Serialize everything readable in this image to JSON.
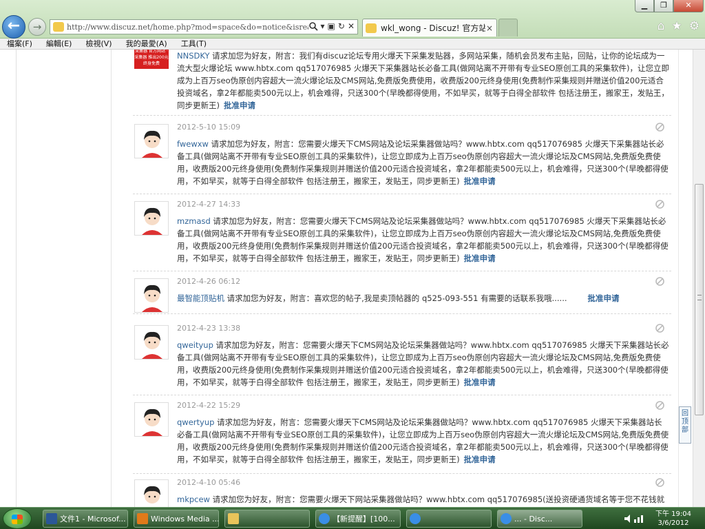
{
  "browser": {
    "url": "http://www.discuz.net/home.php?mod=space&do=notice&isread=1",
    "tab_title": "wkl_wong - Discuz! 官方站 - ...",
    "tab_close": "×",
    "window_minimize": "▁",
    "window_restore": "❐",
    "window_close": "✕",
    "back_glyph": "←",
    "forward_glyph": "→",
    "menu": [
      "檔案(F)",
      "編輯(E)",
      "檢視(V)",
      "我的最愛(A)",
      "工具(T)"
    ]
  },
  "ad_image_text": "采集器 官方网站 · 采集器 推出200元 终身免费",
  "notices": [
    {
      "time": "",
      "user": "NNSDKY",
      "text": " 请求加您为好友，附言：我们有discuz论坛专用火爆天下采集发贴器，多网站采集，随机会员发布主贴，回贴，让你的论坛成为一流大型火爆论坛 www.hbtx.com qq517076985 火爆天下采集器站长必备工具(做网站离不开带有专业SEO原创工具的采集软件)，让您立即成为上百万seo伪原创内容超大一流火爆论坛及CMS网站,免费版免费使用，收费版200元终身使用(免费制作采集规则并赠送价值200元适合投资域名，拿2年都能卖500元以上，机会难得，只送300个(早晚都得使用，不如早买，就等于白得全部软件 包括注册王，搬家王，发贴王，同步更新王)",
      "approve": "批准申请"
    },
    {
      "time": "2012-5-10 15:09",
      "user": "fwewxw",
      "text": " 请求加您为好友，附言：您需要火爆天下CMS网站及论坛采集器做站吗？www.hbtx.com qq517076985 火爆天下采集器站长必备工具(做网站离不开带有专业SEO原创工具的采集软件)，让您立即成为上百万seo伪原创内容超大一流火爆论坛及CMS网站,免费版免费使用，收费版200元终身使用(免费制作采集规则并赠送价值200元适合投资域名，拿2年都能卖500元以上，机会难得，只送300个(早晚都得使用，不如早买，就等于白得全部软件 包括注册王，搬家王，发贴王，同步更新王)",
      "approve": "批准申请"
    },
    {
      "time": "2012-4-27 14:33",
      "user": "mzmasd",
      "text": " 请求加您为好友，附言：您需要火爆天下CMS网站及论坛采集器做站吗？www.hbtx.com qq517076985 火爆天下采集器站长必备工具(做网站离不开带有专业SEO原创工具的采集软件)，让您立即成为上百万seo伪原创内容超大一流火爆论坛及CMS网站,免费版免费使用，收费版200元终身使用(免费制作采集规则并赠送价值200元适合投资域名，拿2年都能卖500元以上，机会难得，只送300个(早晚都得使用，不如早买，就等于白得全部软件 包括注册王，搬家王，发贴王，同步更新王)",
      "approve": "批准申请"
    },
    {
      "time": "2012-4-26 06:12",
      "user": "最智能顶贴机",
      "text": " 请求加您为好友，附言：喜欢您的帖子,我是卖顶帖器的 q525-093-551 有需要的话联系我哦......",
      "approve": "批准申请"
    },
    {
      "time": "2012-4-23 13:38",
      "user": "qweityup",
      "text": " 请求加您为好友，附言：您需要火爆天下CMS网站及论坛采集器做站吗？www.hbtx.com qq517076985 火爆天下采集器站长必备工具(做网站离不开带有专业SEO原创工具的采集软件)，让您立即成为上百万seo伪原创内容超大一流火爆论坛及CMS网站,免费版免费使用，收费版200元终身使用(免费制作采集规则并赠送价值200元适合投资域名，拿2年都能卖500元以上，机会难得，只送300个(早晚都得使用，不如早买，就等于白得全部软件 包括注册王，搬家王，发贴王，同步更新王)",
      "approve": "批准申请"
    },
    {
      "time": "2012-4-22 15:29",
      "user": "qwertyup",
      "text": " 请求加您为好友，附言：您需要火爆天下CMS网站及论坛采集器做站吗？www.hbtx.com qq517076985 火爆天下采集器站长必备工具(做网站离不开带有专业SEO原创工具的采集软件)，让您立即成为上百万seo伪原创内容超大一流火爆论坛及CMS网站,免费版免费使用，收费版200元终身使用(免费制作采集规则并赠送价值200元适合投资域名，拿2年都能卖500元以上，机会难得，只送300个(早晚都得使用，不如早买，就等于白得全部软件 包括注册王，搬家王，发贴王，同步更新王)",
      "approve": "批准申请"
    },
    {
      "time": "2012-4-10 05:46",
      "user": "mkpcew",
      "text": " 请求加您为好友，附言：您需要火爆天下网站采集器做站吗？www.hbtx.com qq517076985(送投资硬通货域名等于您不花钱就",
      "approve": ""
    }
  ],
  "back_to_top": "回顶部",
  "taskbar": {
    "items": [
      {
        "label": "文件1 - Microsof..."
      },
      {
        "label": "Windows Media ..."
      },
      {
        "label": ""
      },
      {
        "label": "【新提醒】[100..."
      },
      {
        "label": ""
      },
      {
        "label": "... - Disc..."
      }
    ],
    "time": "下午 19:04",
    "date": "3/6/2012"
  }
}
